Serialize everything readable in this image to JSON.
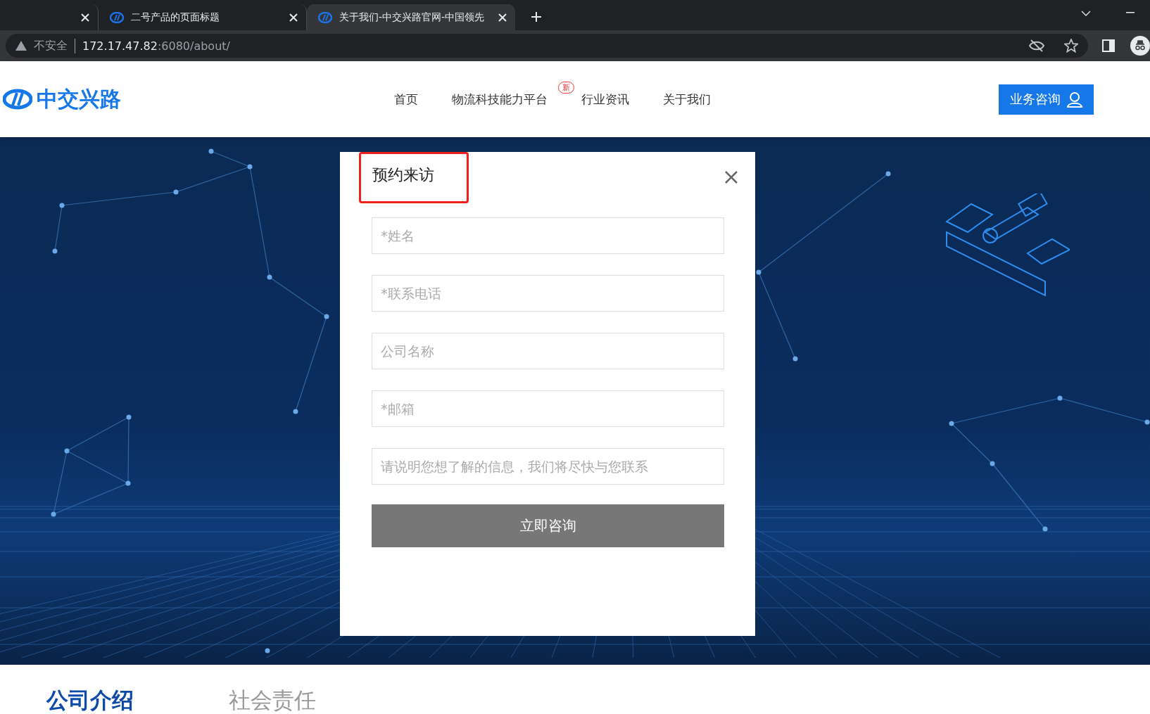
{
  "browser": {
    "tabs": [
      {
        "selected": false
      },
      {
        "title": "二号产品的页面标题",
        "selected": false
      },
      {
        "title": "关于我们-中交兴路官网-中国领先",
        "selected": true
      }
    ],
    "security": "不安全",
    "url_host": "172.17.47.82",
    "url_rest": ":6080/about/"
  },
  "header": {
    "logo": "中交兴路",
    "nav": [
      {
        "label": "首页"
      },
      {
        "label": "物流科技能力平台",
        "badge": "新"
      },
      {
        "label": "行业资讯"
      },
      {
        "label": "关于我们"
      }
    ],
    "consult_button": "业务咨询"
  },
  "modal": {
    "title": "预约来访",
    "title_highlighted": true,
    "fields": [
      {
        "placeholder": "*姓名"
      },
      {
        "placeholder": "*联系电话"
      },
      {
        "placeholder": "公司名称"
      },
      {
        "placeholder": "*邮箱"
      },
      {
        "placeholder": "请说明您想了解的信息，我们将尽快与您联系"
      }
    ],
    "submit": "立即咨询"
  },
  "section_tabs": [
    {
      "label": "公司介绍",
      "selected": true
    },
    {
      "label": "社会责任",
      "selected": false
    }
  ]
}
